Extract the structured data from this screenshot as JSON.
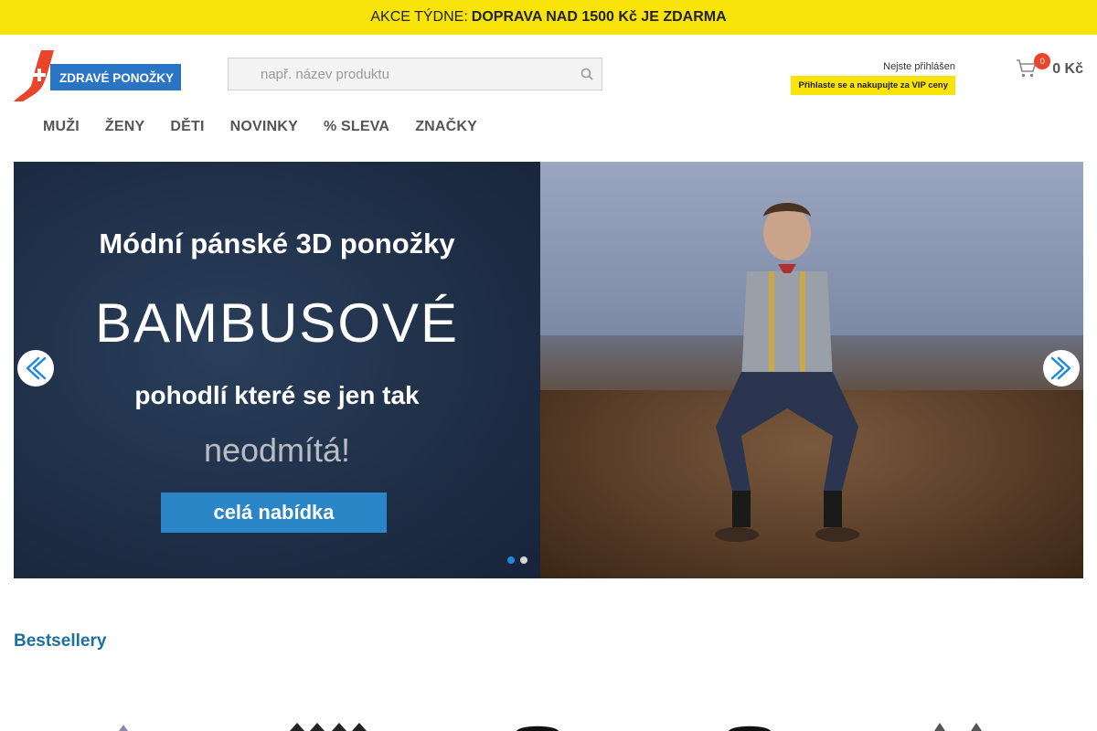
{
  "promo": {
    "prefix": "AKCE TÝDNE:",
    "highlight": "DOPRAVA NAD 1500 Kč JE ZDARMA"
  },
  "logo": {
    "text": "ZDRAVÉ PONOŽKY"
  },
  "search": {
    "placeholder": "např. název produktu"
  },
  "account": {
    "status": "Nejste přihlášen",
    "vip_label": "Přihlaste se a nakupujte za VIP ceny"
  },
  "cart": {
    "count": "0",
    "total": "0 Kč"
  },
  "nav": [
    "MUŽI",
    "ŽENY",
    "DĚTI",
    "NOVINKY",
    "% SLEVA",
    "ZNAČKY"
  ],
  "banner": {
    "line1": "Módní pánské 3D ponožky",
    "line2": "BAMBUSOVÉ",
    "line3": "pohodlí které se jen tak",
    "line4": "neodmítá!",
    "cta": "celá nabídka",
    "active_slide": 1,
    "slide_count": 2
  },
  "bestsellers": {
    "title": "Bestsellery"
  },
  "colors": {
    "promo_bg": "#f8e40b",
    "accent_blue": "#2a86c6",
    "title_blue": "#1d6fa0",
    "badge_red": "#e8452c",
    "logo_red": "#e8452c",
    "logo_blue": "#2a74c4"
  }
}
